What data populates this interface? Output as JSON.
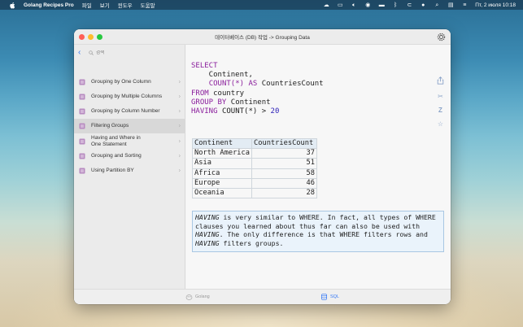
{
  "menubar": {
    "app_name": "Golang Recipes Pro",
    "menus": [
      "파일",
      "보기",
      "윈도우",
      "도움말"
    ],
    "clock": "Пт, 2 июля  10:18"
  },
  "window": {
    "title": "데이터베이스 (DB) 작업 -> Grouping Data",
    "search_placeholder": "검색"
  },
  "sidebar": {
    "items": [
      {
        "label": "Grouping by One Column",
        "selected": false
      },
      {
        "label": "Grouping by Multiple Columns",
        "selected": false
      },
      {
        "label": "Grouping by Column Number",
        "selected": false
      },
      {
        "label": "Filtering Groups",
        "selected": true
      },
      {
        "label_line1": "Having and Where in",
        "label_line2": "One Statement",
        "selected": false
      },
      {
        "label": "Grouping and Sorting",
        "selected": false
      },
      {
        "label": "Using Partition BY",
        "selected": false
      }
    ]
  },
  "code": {
    "select": "SELECT",
    "line2": "    Continent,",
    "count_fn": "COUNT(*)",
    "as_kw": "AS",
    "alias": "CountriesCount",
    "from_kw": "FROM",
    "table": "country",
    "group_kw": "GROUP BY",
    "group_col": "Continent",
    "having_kw": "HAVING",
    "having_expr": "COUNT(*) >",
    "having_val": "20"
  },
  "result": {
    "headers": [
      "Continent",
      "CountriesCount"
    ],
    "rows": [
      [
        "North America",
        "37"
      ],
      [
        "Asia",
        "51"
      ],
      [
        "Africa",
        "58"
      ],
      [
        "Europe",
        "46"
      ],
      [
        "Oceania",
        "28"
      ]
    ]
  },
  "note": {
    "having1": "HAVING",
    "text1": " is very similar to WHERE. In fact, all types of WHERE clauses you learned about thus far can also be used with ",
    "having2": "HAVING",
    "text2": ". The only difference is that WHERE filters rows and ",
    "having3": "HAVING",
    "text3": " filters groups."
  },
  "tabs": {
    "golang": "Golang",
    "sql": "SQL"
  },
  "colors": {
    "accent": "#3478f6",
    "keyword": "#8a1e9c",
    "number": "#2c1fb8",
    "close": "#ff5f57",
    "minimize": "#febc2e",
    "zoom": "#28c840"
  }
}
